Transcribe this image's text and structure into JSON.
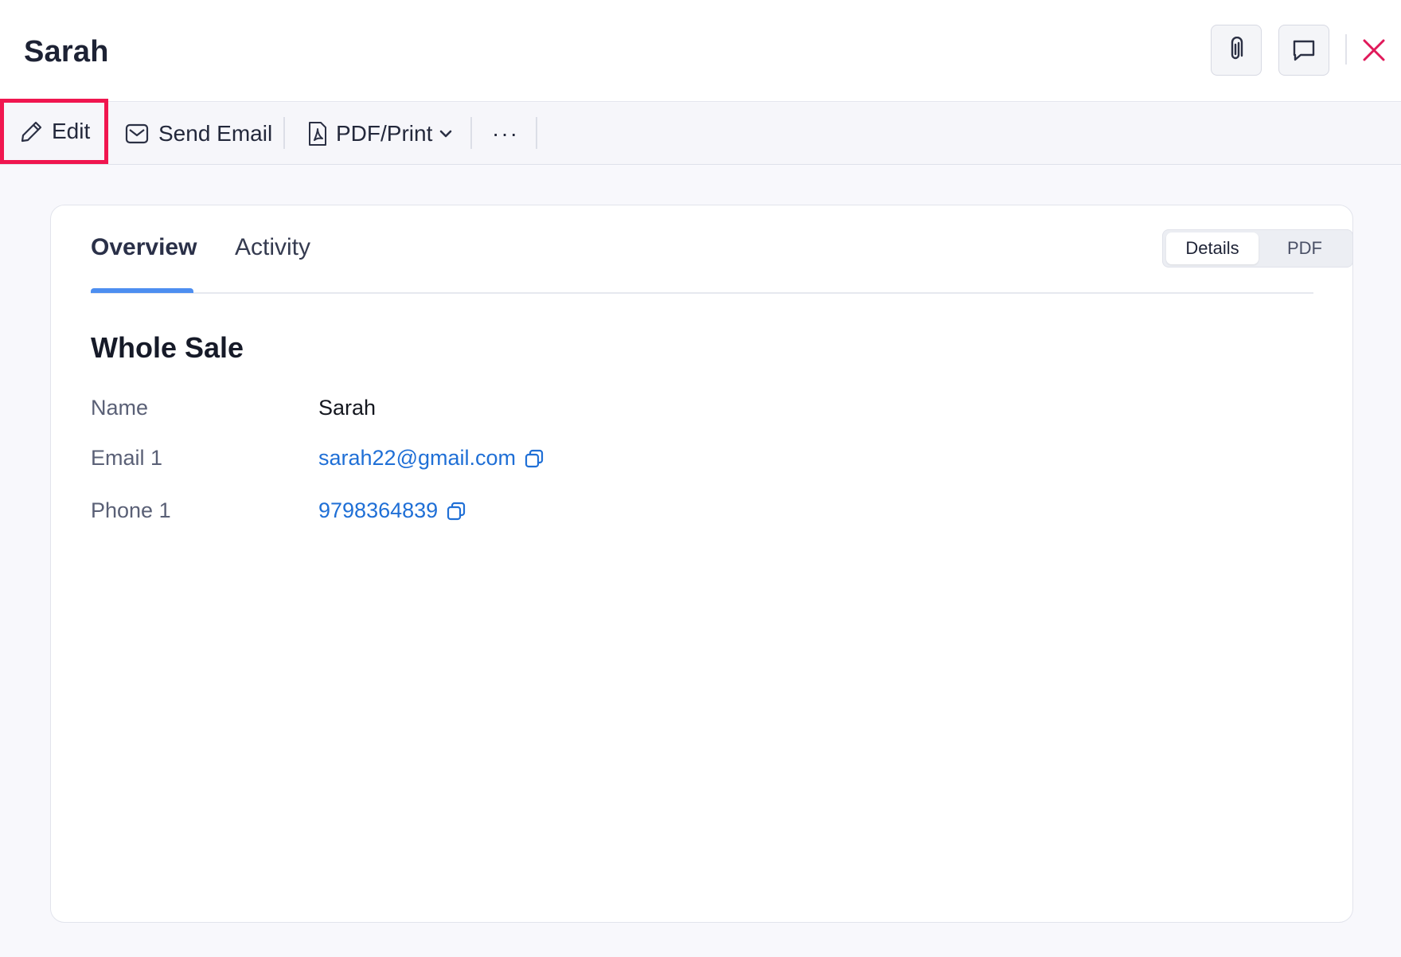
{
  "header": {
    "title": "Sarah",
    "attach_icon": "paperclip-icon",
    "comment_icon": "chat-bubble-icon",
    "close_icon": "close-icon",
    "close_color": "#e0195a"
  },
  "toolbar": {
    "edit_label": "Edit",
    "send_email_label": "Send Email",
    "pdf_print_label": "PDF/Print",
    "more_label": "···",
    "highlight_color": "#f0164f"
  },
  "tabs": [
    {
      "label": "Overview",
      "active": true
    },
    {
      "label": "Activity",
      "active": false
    }
  ],
  "view_toggle": {
    "options": [
      "Details",
      "PDF"
    ],
    "selected": "Details"
  },
  "section": {
    "title": "Whole Sale",
    "fields": [
      {
        "label": "Name",
        "value": "Sarah",
        "link": false
      },
      {
        "label": "Email 1",
        "value": "sarah22@gmail.com",
        "link": true
      },
      {
        "label": "Phone 1",
        "value": "9798364839",
        "link": true
      }
    ]
  },
  "colors": {
    "accent": "#4d8ef0",
    "link": "#1f6fd6"
  }
}
